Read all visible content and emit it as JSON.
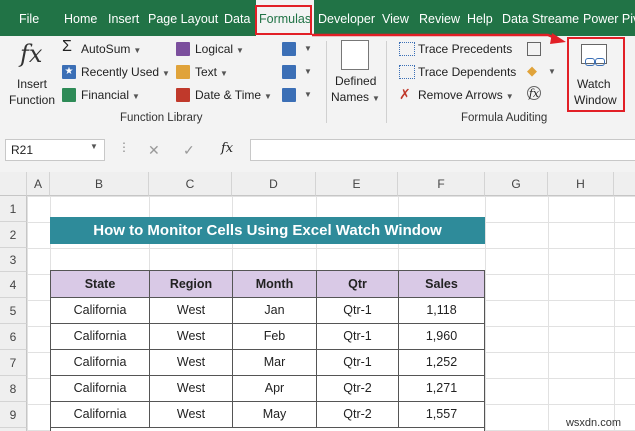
{
  "tabs": [
    "File",
    "Home",
    "Insert",
    "Page Layout",
    "Data",
    "Formulas",
    "Developer",
    "View",
    "Review",
    "Help",
    "Data Streame",
    "Power Piv"
  ],
  "active_tab": "Formulas",
  "ribbon": {
    "insert_function": [
      "Insert",
      "Function"
    ],
    "library": [
      "AutoSum",
      "Recently Used",
      "Financial",
      "Logical",
      "Text",
      "Date & Time"
    ],
    "defined_names": [
      "Defined",
      "Names"
    ],
    "auditing": [
      "Trace Precedents",
      "Trace Dependents",
      "Remove Arrows"
    ],
    "watch_window": [
      "Watch",
      "Window"
    ],
    "group_function_library": "Function Library",
    "group_formula_auditing": "Formula Auditing",
    "highlight_color": "#e21f26"
  },
  "formula_bar": {
    "name_box": "R21",
    "fx": "fx",
    "cancel": "✕",
    "enter": "✓"
  },
  "sheet": {
    "columns": [
      "A",
      "B",
      "C",
      "D",
      "E",
      "F",
      "G",
      "H"
    ],
    "rows": [
      "1",
      "2",
      "3",
      "4",
      "5",
      "6",
      "7",
      "8",
      "9"
    ],
    "title": "How to Monitor Cells Using Excel Watch Window",
    "headers": [
      "State",
      "Region",
      "Month",
      "Qtr",
      "Sales"
    ],
    "data": [
      [
        "California",
        "West",
        "Jan",
        "Qtr-1",
        "1,118"
      ],
      [
        "California",
        "West",
        "Feb",
        "Qtr-1",
        "1,960"
      ],
      [
        "California",
        "West",
        "Mar",
        "Qtr-1",
        "1,252"
      ],
      [
        "California",
        "West",
        "Apr",
        "Qtr-2",
        "1,271"
      ],
      [
        "California",
        "West",
        "May",
        "Qtr-2",
        "1,557"
      ]
    ]
  },
  "watermark": "wsxdn.com"
}
